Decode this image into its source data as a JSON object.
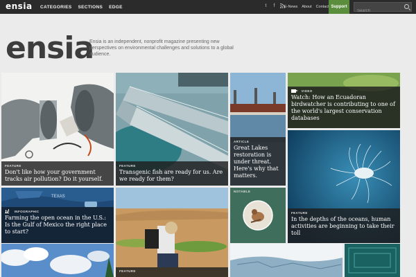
{
  "topbar": {
    "logo": "ensia",
    "nav": [
      "CATEGORIES",
      "SECTIONS",
      "EDGE"
    ],
    "social_icons": [
      "twitter-icon",
      "facebook-icon",
      "rss-icon"
    ],
    "utility": [
      "E-News",
      "About",
      "Contact"
    ],
    "support": "Support",
    "search_placeholder": "Search"
  },
  "header": {
    "logo": "ensia",
    "tagline": "Ensia is an independent, nonprofit magazine presenting new perspectives on environmental challenges and solutions to a global audience."
  },
  "tiles": [
    {
      "tag": "FEATURE",
      "title": "Don't like how your government tracks air pollution? Do it yourself."
    },
    {
      "tag": "FEATURE",
      "title": "Transgenic fish are ready for us. Are we ready for them?"
    },
    {
      "tag": "ARTICLE",
      "title": "Great Lakes restoration is under threat. Here's why that matters."
    },
    {
      "tag": "VIDEO",
      "title": "Watch: How an Ecuadoran birdwatcher is contributing to one of the world's largest conservation databases"
    },
    {
      "tag": "INFOGRAPHIC",
      "title": "Farming the open ocean in the U.S.: Is the Gulf of Mexico the right place to start?"
    },
    {
      "tag": "NOTABLE",
      "title": ""
    },
    {
      "tag": "FEATURE",
      "title": "In the depths of the oceans, human activities are beginning to take their toll"
    },
    {
      "tag": "FEATURE",
      "title": ""
    }
  ],
  "colors": {
    "topbar": "#2b2b2b",
    "support": "#5a8e3c",
    "notable": "#3f6e5d",
    "background": "#ebebeb"
  }
}
